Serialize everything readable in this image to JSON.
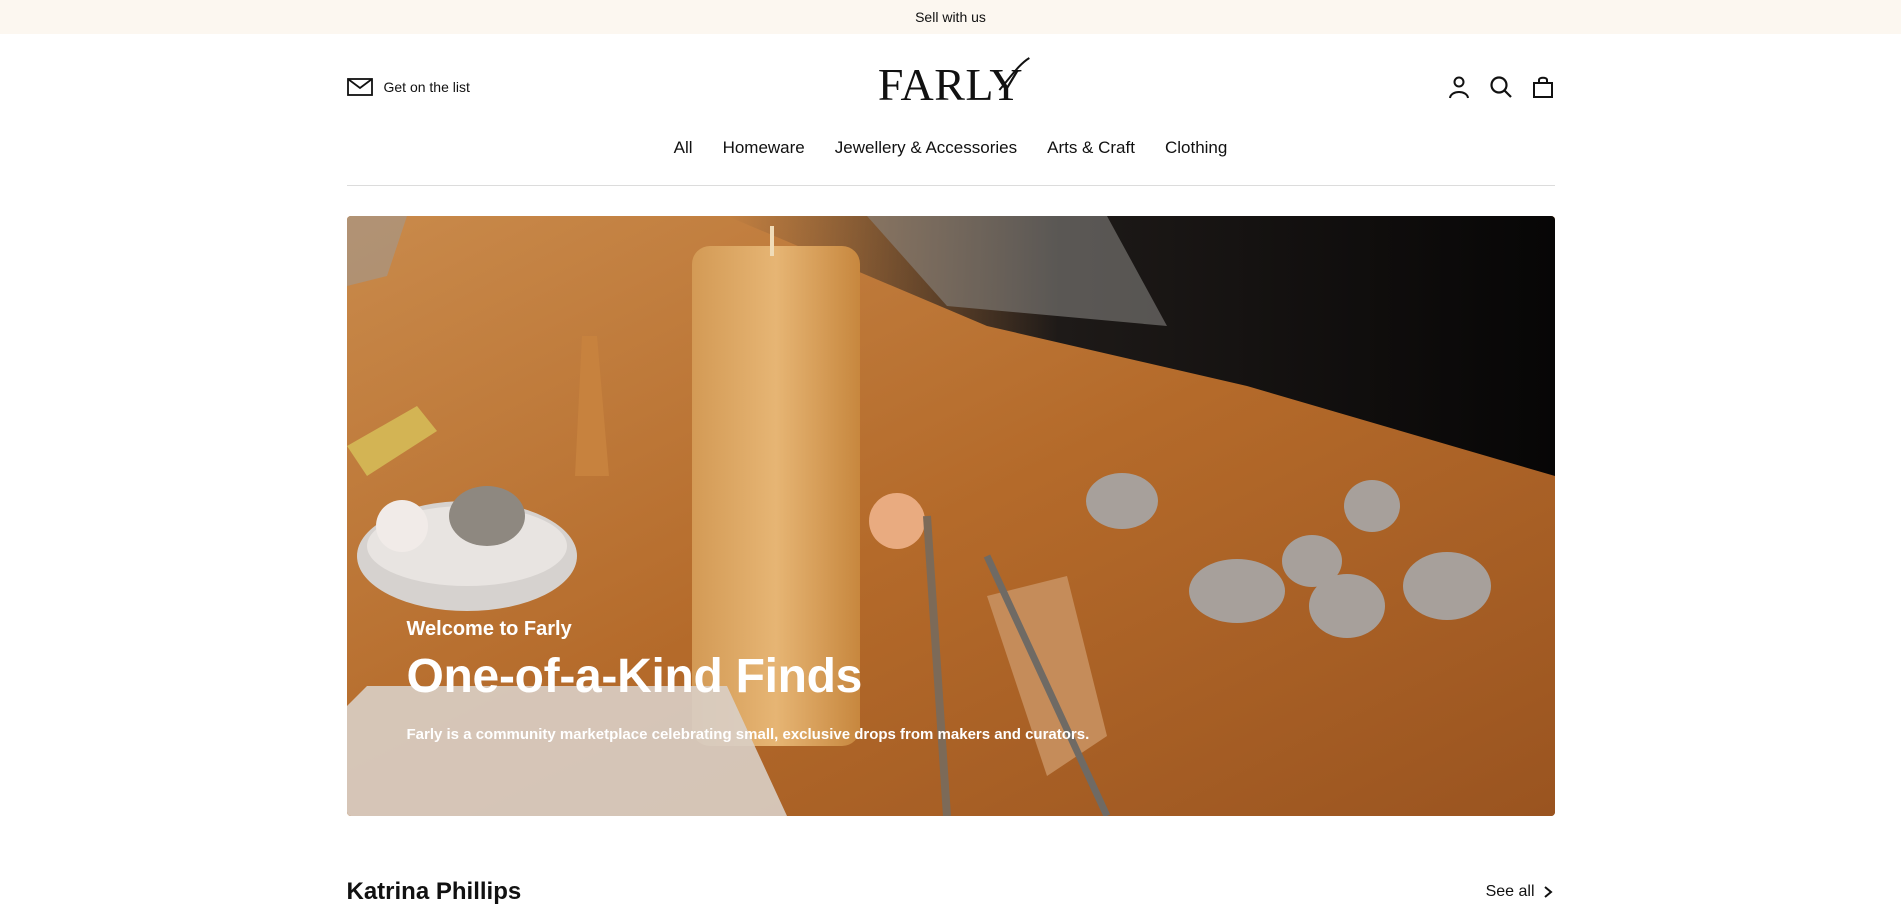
{
  "announcement": {
    "text": "Sell with us"
  },
  "header": {
    "newsletter_label": "Get on the list",
    "logo_text": "FARLY",
    "icons": [
      "account-icon",
      "search-icon",
      "cart-icon"
    ]
  },
  "nav": {
    "items": [
      {
        "label": "All"
      },
      {
        "label": "Homeware"
      },
      {
        "label": "Jewellery & Accessories"
      },
      {
        "label": "Arts & Craft"
      },
      {
        "label": "Clothing"
      }
    ]
  },
  "hero": {
    "eyebrow": "Welcome to Farly",
    "title": "One-of-a-Kind Finds",
    "description": "Farly is a community marketplace celebrating small, exclusive drops from makers and curators."
  },
  "section": {
    "title": "Katrina Phillips",
    "see_all_label": "See all"
  },
  "colors": {
    "announcement_bg": "#fcf7f0",
    "text": "#111111",
    "hero_text": "#ffffff"
  }
}
